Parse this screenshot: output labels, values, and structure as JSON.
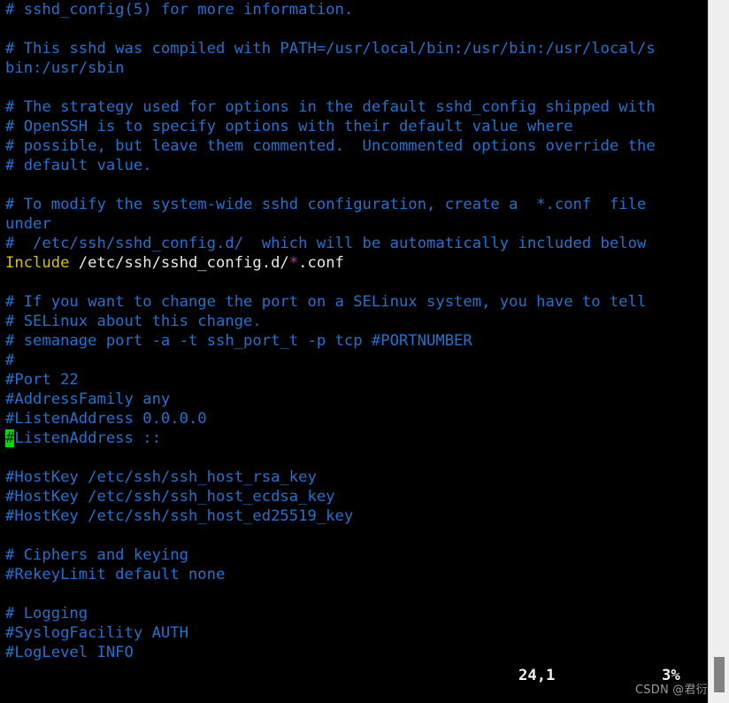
{
  "app": {
    "name": "vim",
    "file": "sshd_config",
    "terminal_bg": "#000000",
    "comment_color": "#2072d1",
    "keyword_color": "#d6c000",
    "path_color": "#e8e8e8",
    "glob_color": "#c030a0",
    "cursor_color": "#00e000"
  },
  "buffer": {
    "lines": [
      {
        "segments": [
          {
            "text": "# sshd_config(5) for more information.",
            "style": "cmt"
          }
        ]
      },
      {
        "segments": [
          {
            "text": "",
            "style": "blank"
          }
        ]
      },
      {
        "segments": [
          {
            "text": "# This sshd was compiled with PATH=/usr/local/bin:/usr/bin:/usr/local/s",
            "style": "cmt"
          }
        ]
      },
      {
        "segments": [
          {
            "text": "bin:/usr/sbin",
            "style": "cmt"
          }
        ]
      },
      {
        "segments": [
          {
            "text": "",
            "style": "blank"
          }
        ]
      },
      {
        "segments": [
          {
            "text": "# The strategy used for options in the default sshd_config shipped with",
            "style": "cmt"
          }
        ]
      },
      {
        "segments": [
          {
            "text": "# OpenSSH is to specify options with their default value where",
            "style": "cmt"
          }
        ]
      },
      {
        "segments": [
          {
            "text": "# possible, but leave them commented.  Uncommented options override the",
            "style": "cmt"
          }
        ]
      },
      {
        "segments": [
          {
            "text": "# default value.",
            "style": "cmt"
          }
        ]
      },
      {
        "segments": [
          {
            "text": "",
            "style": "blank"
          }
        ]
      },
      {
        "segments": [
          {
            "text": "# To modify the system-wide sshd configuration, create a  *.conf  file",
            "style": "cmt"
          }
        ]
      },
      {
        "segments": [
          {
            "text": "under",
            "style": "cmt"
          }
        ]
      },
      {
        "segments": [
          {
            "text": "#  /etc/ssh/sshd_config.d/  which will be automatically included below",
            "style": "cmt"
          }
        ]
      },
      {
        "segments": [
          {
            "text": "Include",
            "style": "kw"
          },
          {
            "text": " /etc/ssh/sshd_config.d/",
            "style": "path"
          },
          {
            "text": "*",
            "style": "star"
          },
          {
            "text": ".conf",
            "style": "path"
          }
        ]
      },
      {
        "segments": [
          {
            "text": "",
            "style": "blank"
          }
        ]
      },
      {
        "segments": [
          {
            "text": "# If you want to change the port on a SELinux system, you have to tell",
            "style": "cmt"
          }
        ]
      },
      {
        "segments": [
          {
            "text": "# SELinux about this change.",
            "style": "cmt"
          }
        ]
      },
      {
        "segments": [
          {
            "text": "# semanage port -a -t ssh_port_t -p tcp #PORTNUMBER",
            "style": "cmt"
          }
        ]
      },
      {
        "segments": [
          {
            "text": "#",
            "style": "cmt"
          }
        ]
      },
      {
        "segments": [
          {
            "text": "#Port 22",
            "style": "cmt"
          }
        ]
      },
      {
        "segments": [
          {
            "text": "#AddressFamily any",
            "style": "cmt"
          }
        ]
      },
      {
        "segments": [
          {
            "text": "#ListenAddress 0.0.0.0",
            "style": "cmt"
          }
        ]
      },
      {
        "segments": [
          {
            "text": "#",
            "style": "cursor"
          },
          {
            "text": "ListenAddress ::",
            "style": "cmt"
          }
        ]
      },
      {
        "segments": [
          {
            "text": "",
            "style": "blank"
          }
        ]
      },
      {
        "segments": [
          {
            "text": "#HostKey /etc/ssh/ssh_host_rsa_key",
            "style": "cmt"
          }
        ]
      },
      {
        "segments": [
          {
            "text": "#HostKey /etc/ssh/ssh_host_ecdsa_key",
            "style": "cmt"
          }
        ]
      },
      {
        "segments": [
          {
            "text": "#HostKey /etc/ssh/ssh_host_ed25519_key",
            "style": "cmt"
          }
        ]
      },
      {
        "segments": [
          {
            "text": "",
            "style": "blank"
          }
        ]
      },
      {
        "segments": [
          {
            "text": "# Ciphers and keying",
            "style": "cmt"
          }
        ]
      },
      {
        "segments": [
          {
            "text": "#RekeyLimit default none",
            "style": "cmt"
          }
        ]
      },
      {
        "segments": [
          {
            "text": "",
            "style": "blank"
          }
        ]
      },
      {
        "segments": [
          {
            "text": "# Logging",
            "style": "cmt"
          }
        ]
      },
      {
        "segments": [
          {
            "text": "#SyslogFacility AUTH",
            "style": "cmt"
          }
        ]
      },
      {
        "segments": [
          {
            "text": "#LogLevel INFO",
            "style": "cmt"
          }
        ]
      }
    ]
  },
  "status": {
    "cursor_position": "24,1",
    "scroll_percent": "3%"
  },
  "watermark": {
    "text": "CSDN @君衍."
  },
  "scrollbar": {
    "orientation": "vertical"
  }
}
